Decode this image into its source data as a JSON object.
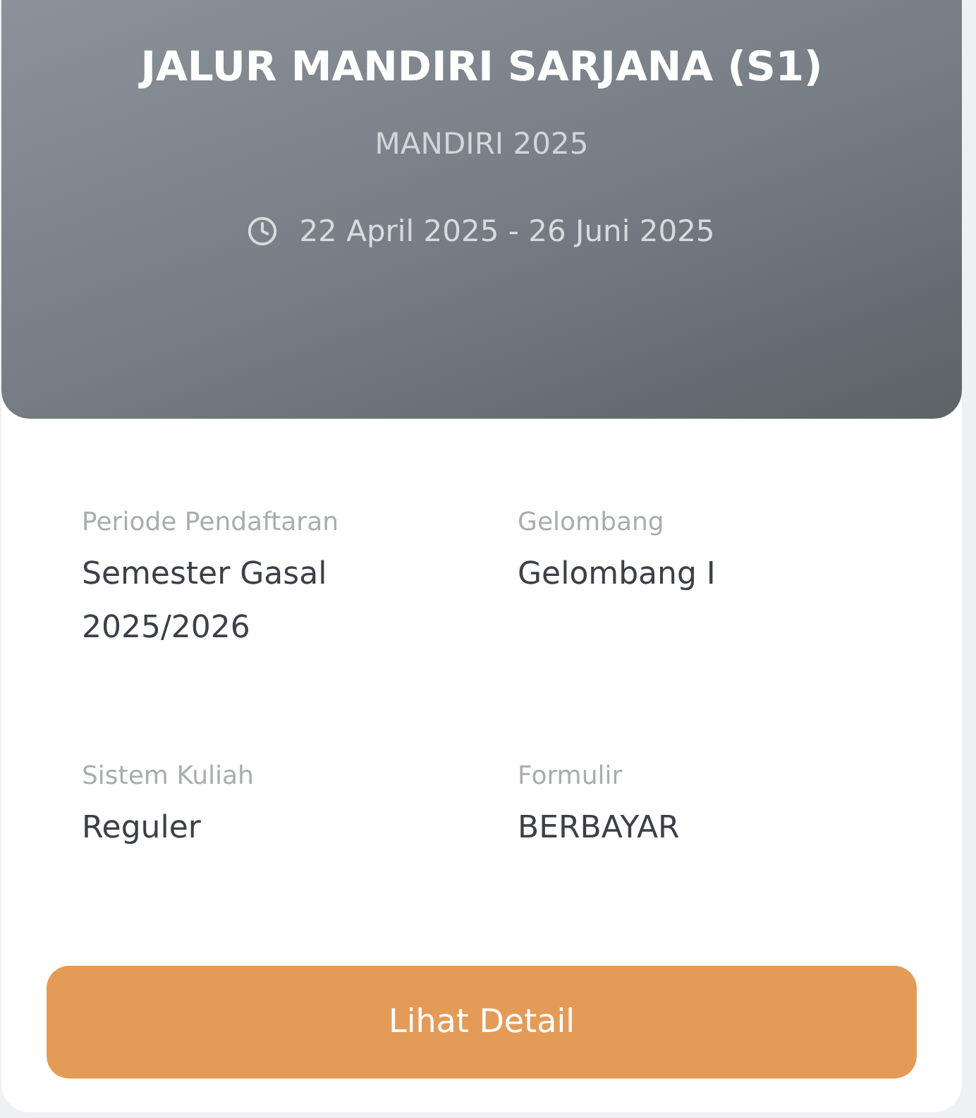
{
  "header": {
    "title": "JALUR MANDIRI SARJANA (S1)",
    "subtitle": "MANDIRI 2025",
    "date_range": "22 April 2025 - 26 Juni 2025"
  },
  "details": [
    {
      "label": "Periode Pendaftaran",
      "value": "Semester Gasal 2025/2026"
    },
    {
      "label": "Gelombang",
      "value": "Gelombang I"
    },
    {
      "label": "Sistem Kuliah",
      "value": "Reguler"
    },
    {
      "label": "Formulir",
      "value": "BERBAYAR"
    }
  ],
  "button": {
    "label": "Lihat Detail"
  }
}
